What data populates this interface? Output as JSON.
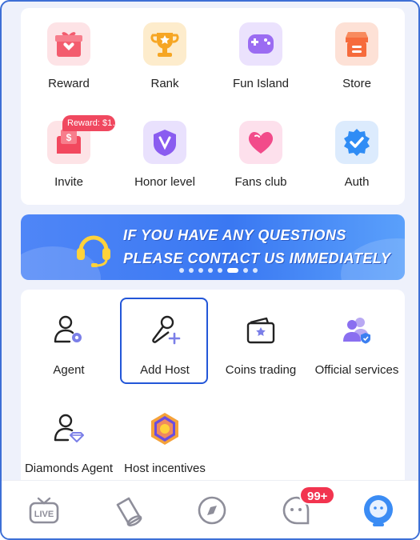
{
  "grid_top": [
    {
      "label": "Reward",
      "icon": "gift-icon",
      "color": "#f35c6e"
    },
    {
      "label": "Rank",
      "icon": "trophy-icon",
      "color": "#f6a623"
    },
    {
      "label": "Fun Island",
      "icon": "gamepad-icon",
      "color": "#9b6cf2"
    },
    {
      "label": "Store",
      "icon": "store-icon",
      "color": "#f66b3c"
    },
    {
      "label": "Invite",
      "icon": "envelope-icon",
      "color": "#f2485e"
    },
    {
      "label": "Honor level",
      "icon": "honor-shield-icon",
      "color": "#8a5cf0"
    },
    {
      "label": "Fans club",
      "icon": "heart-icon",
      "color": "#f24b8a"
    },
    {
      "label": "Auth",
      "icon": "verified-badge-icon",
      "color": "#2f8cf5"
    }
  ],
  "invite_badge": "Reward: $1…",
  "banner": {
    "line1": "IF YOU HAVE ANY QUESTIONS",
    "line2": "PLEASE CONTACT US IMMEDIATELY",
    "slides": 8,
    "active_slide": 5
  },
  "grid_bottom": [
    {
      "label": "Agent",
      "icon": "agent-icon"
    },
    {
      "label": "Add Host",
      "icon": "microphone-add-icon",
      "selected": true
    },
    {
      "label": "Coins trading",
      "icon": "wallet-icon"
    },
    {
      "label": "Official services",
      "icon": "official-users-icon"
    },
    {
      "label": "Diamonds Agent",
      "icon": "diamond-agent-icon"
    },
    {
      "label": "Host incentives",
      "icon": "host-incentive-medal-icon"
    }
  ],
  "tabbar": {
    "tabs": [
      "live-tab",
      "bucket-tab",
      "discover-tab",
      "messages-tab",
      "me-tab"
    ],
    "messages_badge": "99+"
  },
  "colors": {
    "accent": "#2356d8",
    "badge": "#f2344f"
  }
}
